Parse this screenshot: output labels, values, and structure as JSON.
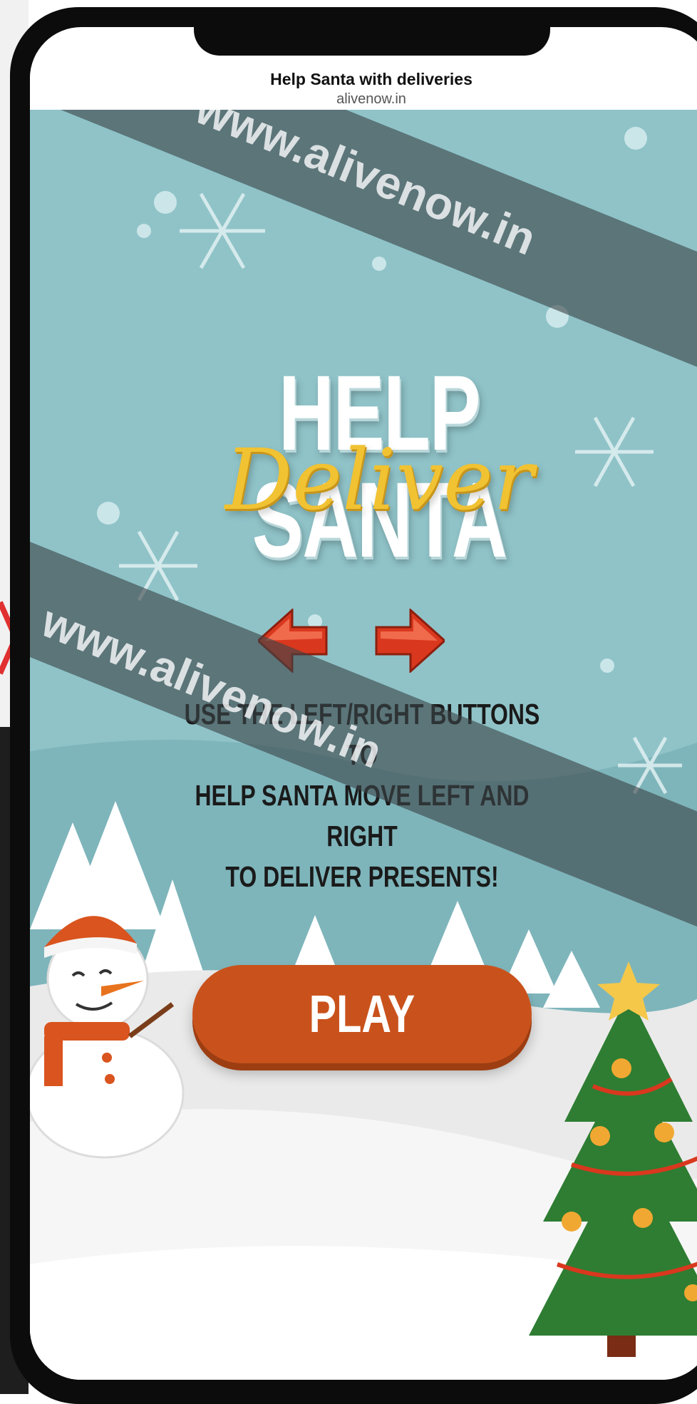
{
  "browser": {
    "page_title": "Help Santa with deliveries",
    "page_url": "alivenow.in"
  },
  "game": {
    "title_line1": "HELP SANTA",
    "title_line2": "Deliver",
    "instructions": "USE THE LEFT/RIGHT BUTTONS TO\nHELP SANTA MOVE LEFT AND RIGHT\nTO DELIVER PRESENTS!",
    "play_label": "PLAY",
    "left_arrow_icon": "arrow-left-icon",
    "right_arrow_icon": "arrow-right-icon"
  },
  "watermark": {
    "text": "www.alivenow.in"
  },
  "colors": {
    "sky": "#8fc3c8",
    "title_white": "#ffffff",
    "deliver_gold": "#f1c232",
    "play_button": "#c9521c",
    "arrow_red": "#d9381e",
    "tree_green": "#2e7d32"
  }
}
